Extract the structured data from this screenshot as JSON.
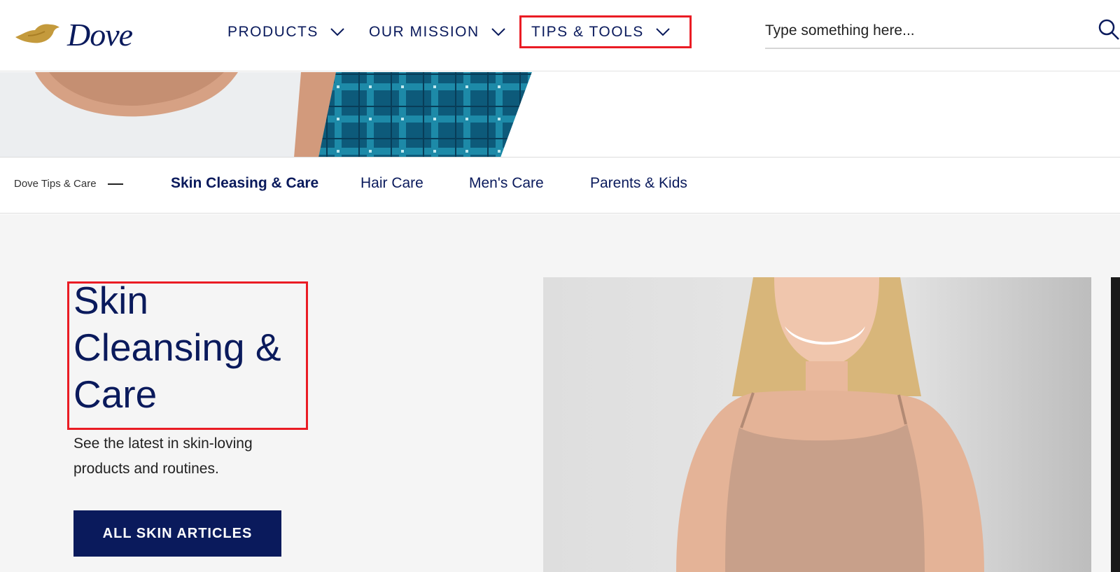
{
  "header": {
    "logo_text": "Dove",
    "nav": [
      {
        "label": "PRODUCTS",
        "icon": "chevron-down-icon"
      },
      {
        "label": "OUR MISSION",
        "icon": "chevron-down-icon"
      },
      {
        "label": "TIPS & TOOLS",
        "icon": "chevron-down-icon"
      }
    ],
    "search": {
      "placeholder": "Type something here...",
      "icon": "search-icon"
    }
  },
  "subnav": {
    "breadcrumb": "Dove Tips & Care",
    "links": [
      {
        "label": "Skin Cleasing & Care",
        "active": true
      },
      {
        "label": "Hair Care",
        "active": false
      },
      {
        "label": "Men's Care",
        "active": false
      },
      {
        "label": "Parents & Kids",
        "active": false
      }
    ]
  },
  "main": {
    "title": "Skin Cleansing & Care",
    "description": "See the latest in skin-loving products and routines.",
    "cta_label": "ALL SKIN ARTICLES"
  },
  "colors": {
    "brand_navy": "#0a1a5c",
    "logo_gold": "#c49a3c",
    "highlight_red": "#ea1c24",
    "content_bg": "#f5f5f5"
  }
}
